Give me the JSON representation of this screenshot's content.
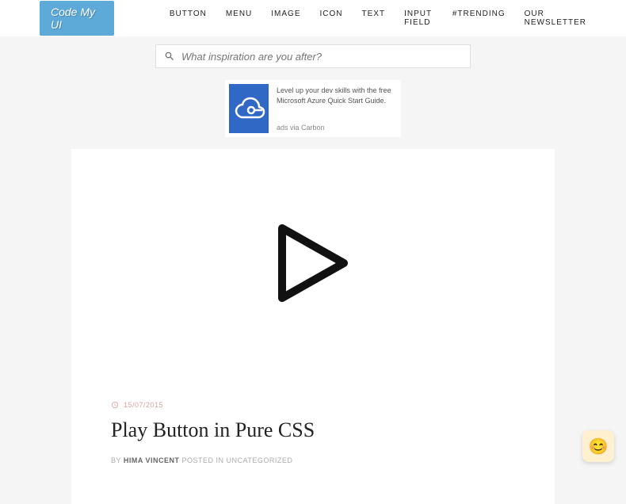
{
  "logo": "Code My UI",
  "nav": {
    "items": [
      "BUTTON",
      "MENU",
      "IMAGE",
      "ICON",
      "TEXT",
      "INPUT FIELD",
      "#TRENDING",
      "OUR NEWSLETTER"
    ]
  },
  "search": {
    "placeholder": "What inspiration are you after?"
  },
  "ad": {
    "text": "Level up your dev skills with the free Microsoft Azure Quick Start Guide.",
    "via": "ads via Carbon"
  },
  "article": {
    "date": "15/07/2015",
    "title": "Play Button in Pure CSS",
    "by": "BY ",
    "author": "HIMA VINCENT",
    "posted": " POSTED IN UNCATEGORIZED"
  },
  "chat": {
    "emoji": "😊"
  }
}
